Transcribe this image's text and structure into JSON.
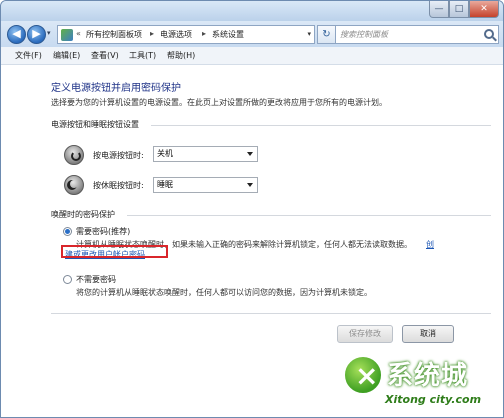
{
  "window": {
    "minimize_glyph": "—",
    "maximize_glyph": "□",
    "close_glyph": "✕"
  },
  "nav": {
    "back_glyph": "◀",
    "forward_glyph": "▶",
    "breadcrumb_prefix": "«",
    "breadcrumbs": [
      "所有控制面板项",
      "电源选项",
      "系统设置"
    ],
    "separator": "▸",
    "refresh_glyph": "↻",
    "search_placeholder": "搜索控制面板"
  },
  "menu": {
    "items": [
      "文件(F)",
      "编辑(E)",
      "查看(V)",
      "工具(T)",
      "帮助(H)"
    ]
  },
  "page": {
    "heading": "定义电源按钮并启用密码保护",
    "subtitle": "选择要为您的计算机设置的电源设置。在此页上对设置所做的更改将应用于您所有的电源计划。",
    "buttons_group_title": "电源按钮和睡眠按钮设置",
    "power_button_label": "按电源按钮时:",
    "power_button_value": "关机",
    "sleep_button_label": "按休眠按钮时:",
    "sleep_button_value": "睡眠",
    "password_group_title": "唤醒时的密码保护",
    "option_require": {
      "label": "需要密码(推荐)",
      "desc": "计算机从睡眠状态唤醒时，如果未输入正确的密码来解除计算机锁定，任何人都无法读取数据。",
      "link_tail": "创",
      "link_main": "建或更改用户帐户密码"
    },
    "option_none": {
      "label": "不需要密码",
      "desc": "将您的计算机从睡眠状态唤醒时，任何人都可以访问您的数据，因为计算机未锁定。"
    },
    "save_button": "保存修改",
    "cancel_button": "取消"
  },
  "watermark": {
    "text": "系统城",
    "url": "Xitong city.com"
  },
  "colors": {
    "heading": "#1e3287",
    "link": "#1b55b3",
    "highlight": "#d9262b"
  }
}
